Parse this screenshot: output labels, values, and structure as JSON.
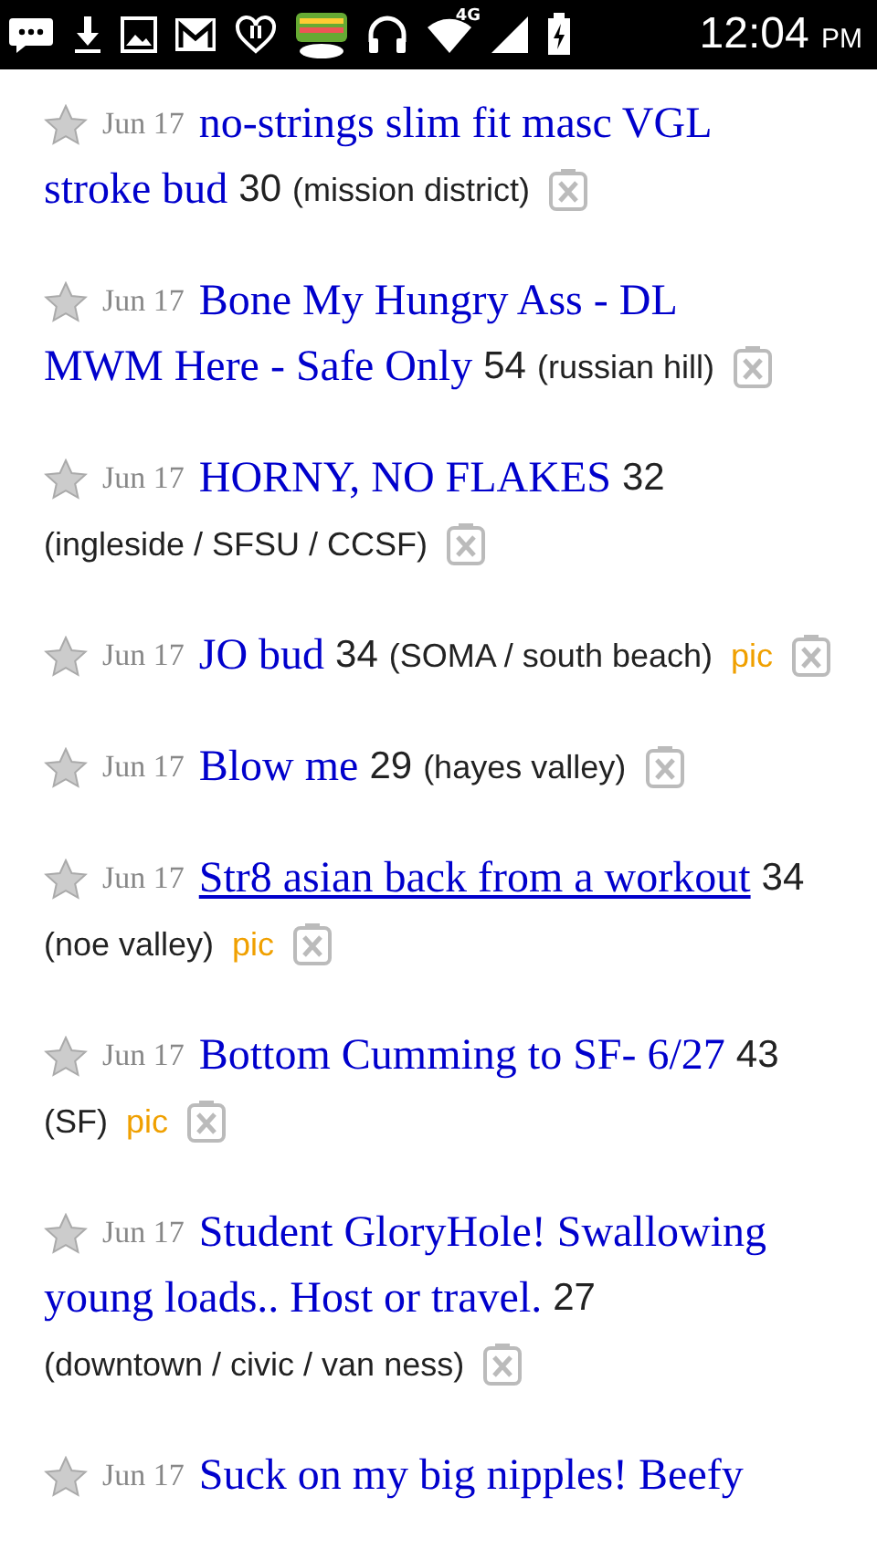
{
  "status_bar": {
    "time": "12:04",
    "ampm": "PM",
    "network": "4G"
  },
  "listings": [
    {
      "date": "Jun 17",
      "title_lines": [
        "no-strings slim fit masc VGL",
        "stroke bud"
      ],
      "age": "30",
      "location": "(mission district)",
      "pic": false,
      "underlined": false
    },
    {
      "date": "Jun 17",
      "title_lines": [
        "Bone My Hungry Ass - DL",
        "MWM Here - Safe Only"
      ],
      "age": "54",
      "location": "(russian hill)",
      "pic": false,
      "underlined": false
    },
    {
      "date": "Jun 17",
      "title_lines": [
        "HORNY, NO FLAKES"
      ],
      "age": "32",
      "location": "(ingleside / SFSU / CCSF)",
      "pic": false,
      "underlined": false
    },
    {
      "date": "Jun 17",
      "title_lines": [
        "JO bud"
      ],
      "age": "34",
      "location": "(SOMA / south beach)",
      "pic": true,
      "pic_label": "pic",
      "underlined": false
    },
    {
      "date": "Jun 17",
      "title_lines": [
        "Blow me"
      ],
      "age": "29",
      "location": "(hayes valley)",
      "pic": false,
      "underlined": false
    },
    {
      "date": "Jun 17",
      "title_lines": [
        "Str8 asian back from a workout"
      ],
      "age": "34",
      "location": "(noe valley)",
      "pic": true,
      "pic_label": "pic",
      "underlined": true
    },
    {
      "date": "Jun 17",
      "title_lines": [
        "Bottom Cumming to SF- 6/27"
      ],
      "age": "43",
      "location": "(SF)",
      "pic": true,
      "pic_label": "pic",
      "underlined": false
    },
    {
      "date": "Jun 17",
      "title_lines": [
        "Student GloryHole! Swallowing",
        "young loads.. Host or travel."
      ],
      "age": "27",
      "location": "(downtown / civic / van ness)",
      "pic": false,
      "underlined": false
    },
    {
      "date": "Jun 17",
      "title_lines": [
        "Suck on my big nipples! Beefy"
      ],
      "pic": false,
      "underlined": false
    }
  ]
}
